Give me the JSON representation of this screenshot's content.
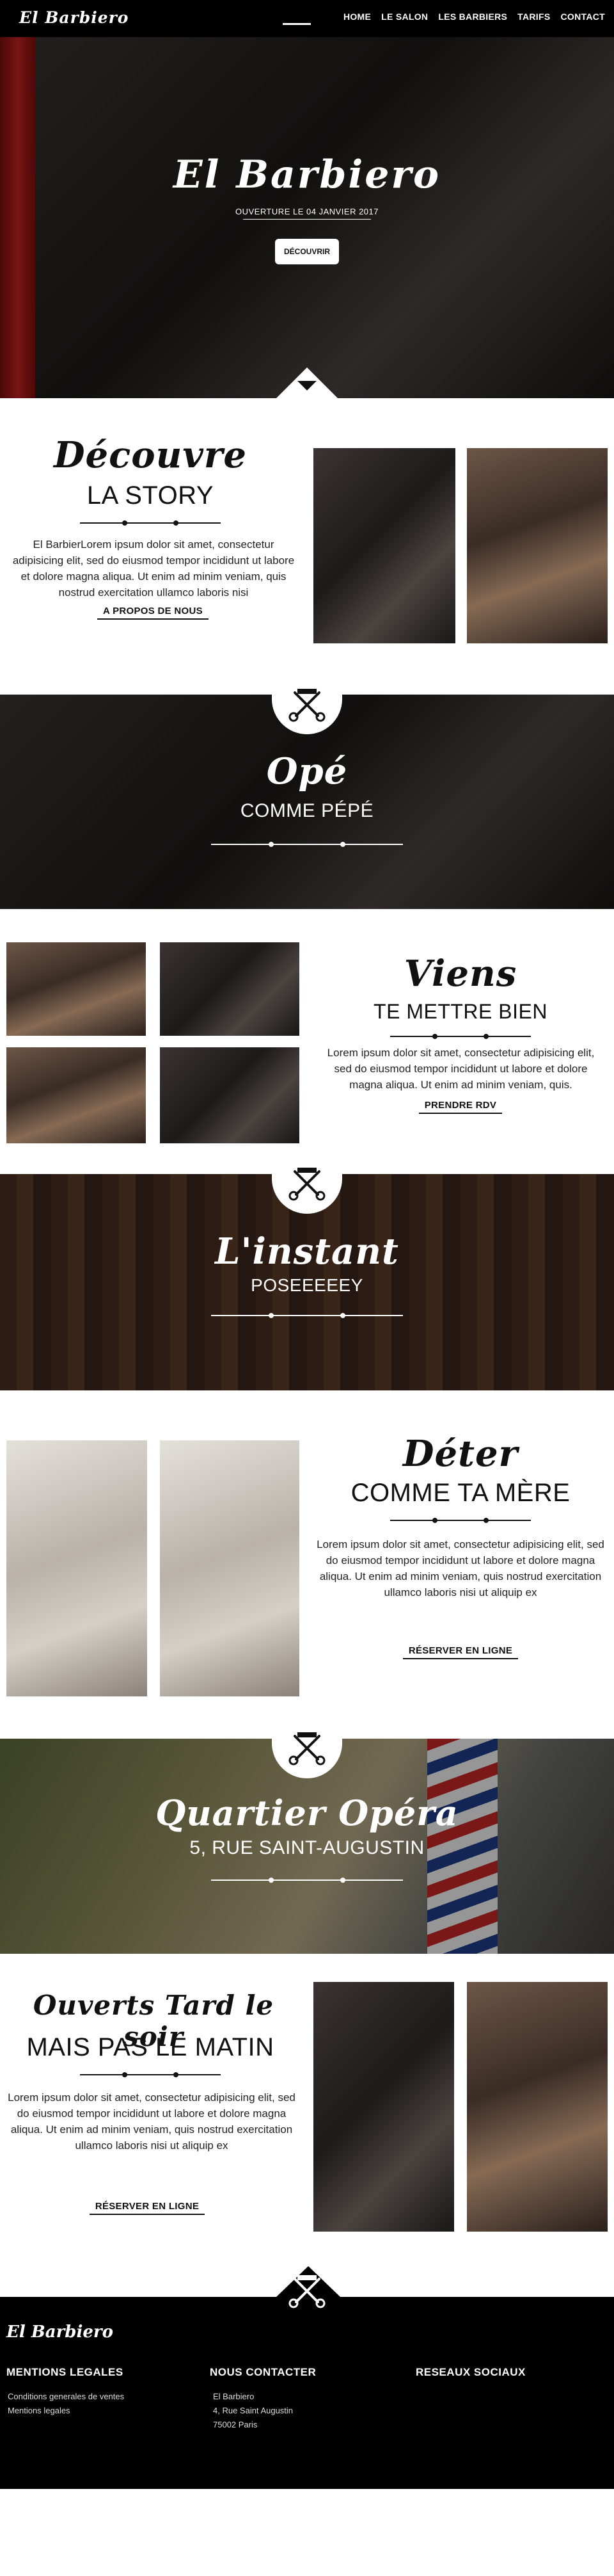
{
  "header": {
    "logo": "El Barbiero",
    "nav": [
      "HOME",
      "LE SALON",
      "LES BARBIERS",
      "TARIFS",
      "CONTACT"
    ]
  },
  "hero": {
    "title": "El Barbiero",
    "subtitle": "OUVERTURE LE 04 JANVIER 2017",
    "button": "DÉCOUVRIR"
  },
  "story": {
    "script_title": "Découvre",
    "caps_title": "LA STORY",
    "text": "El BarbierLorem ipsum dolor sit amet, consectetur adipisicing elit, sed do eiusmod tempor incididunt ut labore et dolore magna aliqua. Ut enim ad minim veniam, quis nostrud exercitation ullamco laboris nisi",
    "link": "A PROPOS DE NOUS"
  },
  "ope": {
    "script_title": "Opé",
    "caps_title": "COMME PÉPÉ"
  },
  "viens": {
    "script_title": "Viens",
    "caps_title": "TE METTRE BIEN",
    "text": "Lorem ipsum dolor sit amet, consectetur adipisicing elit, sed do eiusmod tempor incididunt ut labore et dolore magna aliqua. Ut enim ad minim veniam, quis.",
    "link": "PRENDRE RDV"
  },
  "instant": {
    "script_title": "L'instant",
    "caps_title": "POSEEEEEY"
  },
  "deter": {
    "script_title": "Déter",
    "caps_title": "COMME TA MÈRE",
    "text": "Lorem ipsum dolor sit amet, consectetur adipisicing elit, sed do eiusmod tempor incididunt ut labore et dolore magna aliqua. Ut enim ad minim veniam, quis nostrud exercitation ullamco laboris nisi ut aliquip ex",
    "link": "RÉSERVER EN LIGNE"
  },
  "quartier": {
    "script_title": "Quartier Opéra",
    "caps_title": "5, RUE SAINT-AUGUSTIN"
  },
  "ouverts": {
    "script_title": "Ouverts Tard le soir",
    "caps_title": "MAIS PAS LE MATIN",
    "text": "Lorem ipsum dolor sit amet, consectetur adipisicing elit, sed do eiusmod tempor incididunt ut labore et dolore magna aliqua. Ut enim ad minim veniam, quis nostrud exercitation ullamco laboris nisi ut aliquip ex",
    "link": "RÉSERVER EN LIGNE"
  },
  "footer": {
    "logo": "El Barbiero",
    "col1_title": "MENTIONS LEGALES",
    "col1_items": [
      "Conditions generales de ventes",
      "Mentions legales"
    ],
    "col2_title": "NOUS CONTACTER",
    "col2_items": [
      "El Barbiero",
      "4, Rue Saint Augustin",
      "75002 Paris"
    ],
    "col3_title": "RESEAUX SOCIAUX"
  },
  "icons": {
    "scissors": "scissors-comb-icon",
    "arrow": "chevron-down-icon",
    "burger": "menu-icon"
  }
}
